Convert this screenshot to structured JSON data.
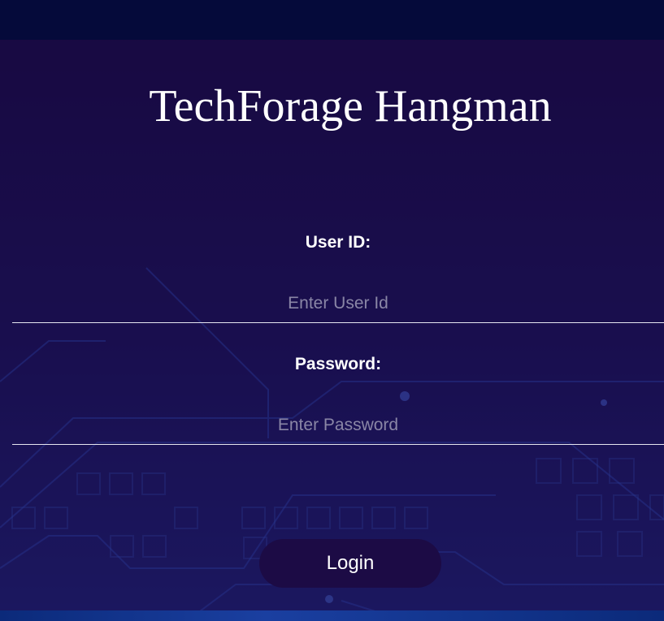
{
  "app": {
    "title": "TechForage Hangman"
  },
  "login_form": {
    "user_id": {
      "label": "User ID:",
      "placeholder": "Enter User Id",
      "value": ""
    },
    "password": {
      "label": "Password:",
      "placeholder": "Enter Password",
      "value": ""
    },
    "submit_label": "Login"
  },
  "colors": {
    "background": "#0d0a3a",
    "panel": "#1e0a46",
    "button": "#1c0b45",
    "text": "#ffffff",
    "placeholder": "#8a86a6",
    "circuit_lines": "#2f5fd8"
  }
}
